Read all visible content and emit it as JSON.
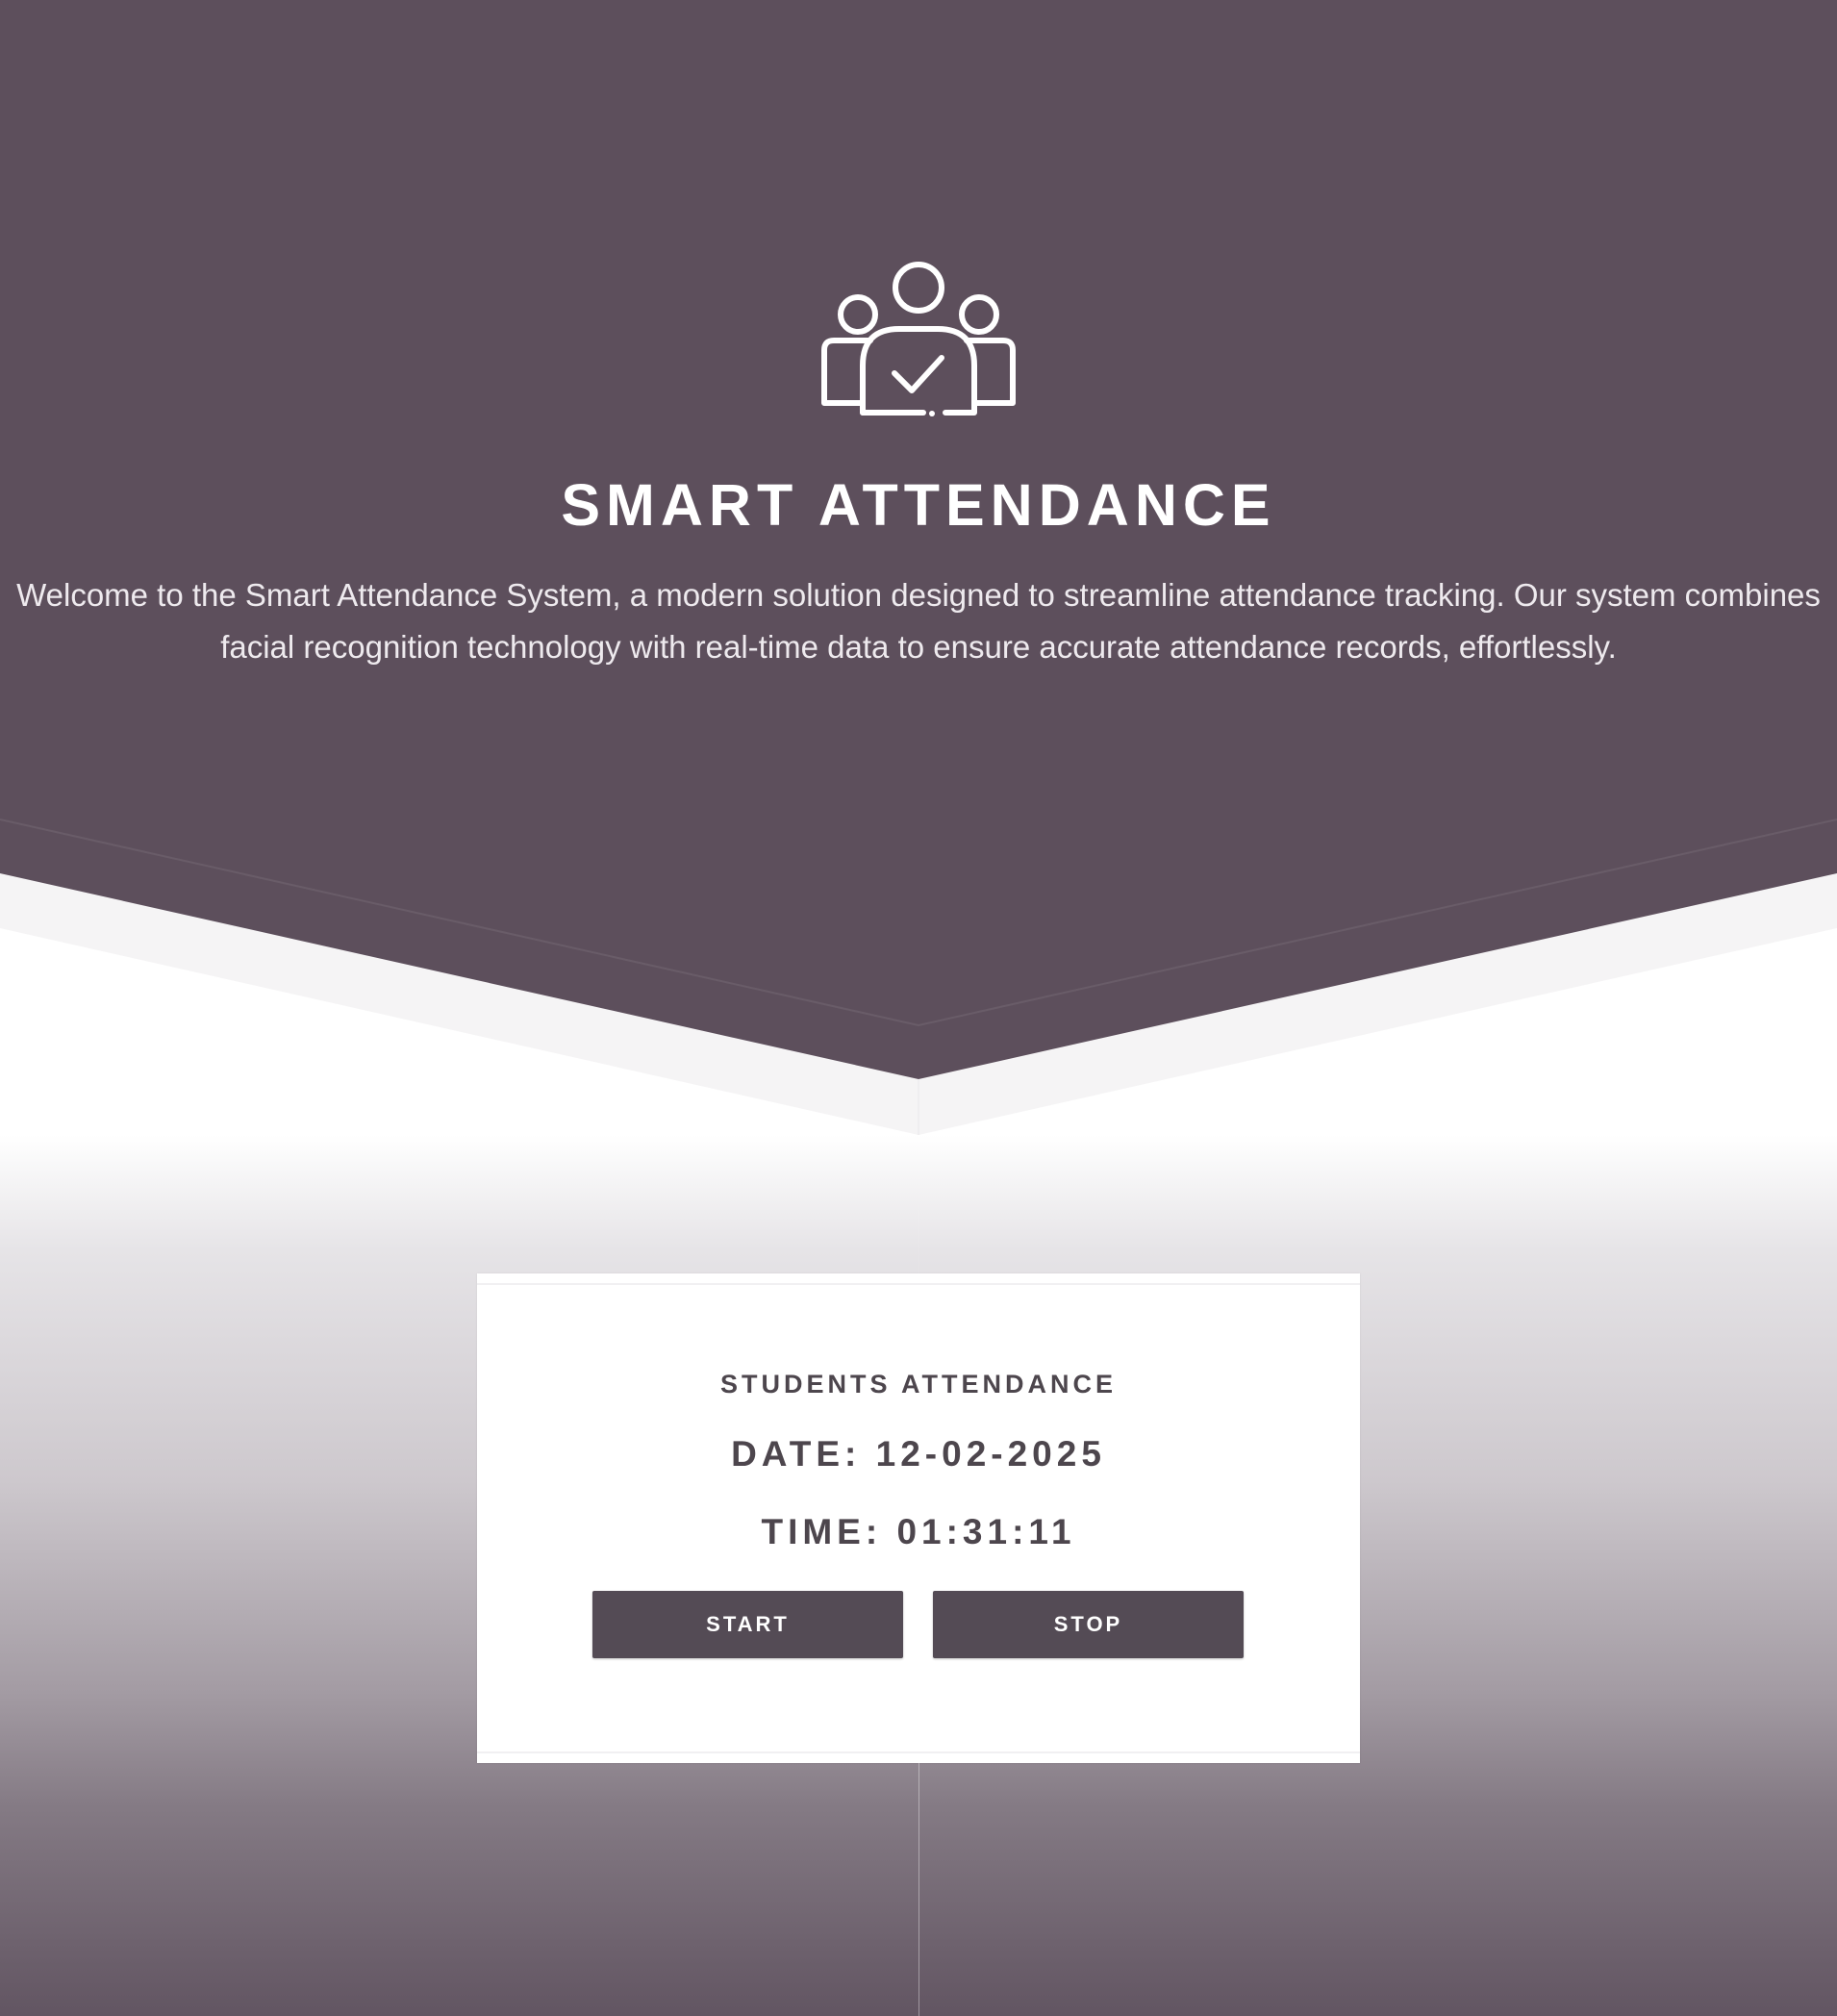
{
  "hero": {
    "title": "SMART ATTENDANCE",
    "description": "Welcome to the Smart Attendance System, a modern solution designed to streamline attendance tracking. Our system combines facial recognition technology with real-time data to ensure accurate attendance records, effortlessly.",
    "icon": "group-check-icon"
  },
  "card": {
    "heading": "STUDENTS ATTENDANCE",
    "date": "DATE: 12-02-2025",
    "time": "TIME: 01:31:11",
    "start_label": "START",
    "stop_label": "STOP"
  },
  "colors": {
    "hero_bg": "#5d4f5c",
    "button_bg": "#544b55",
    "text_dark": "#4d464d"
  }
}
